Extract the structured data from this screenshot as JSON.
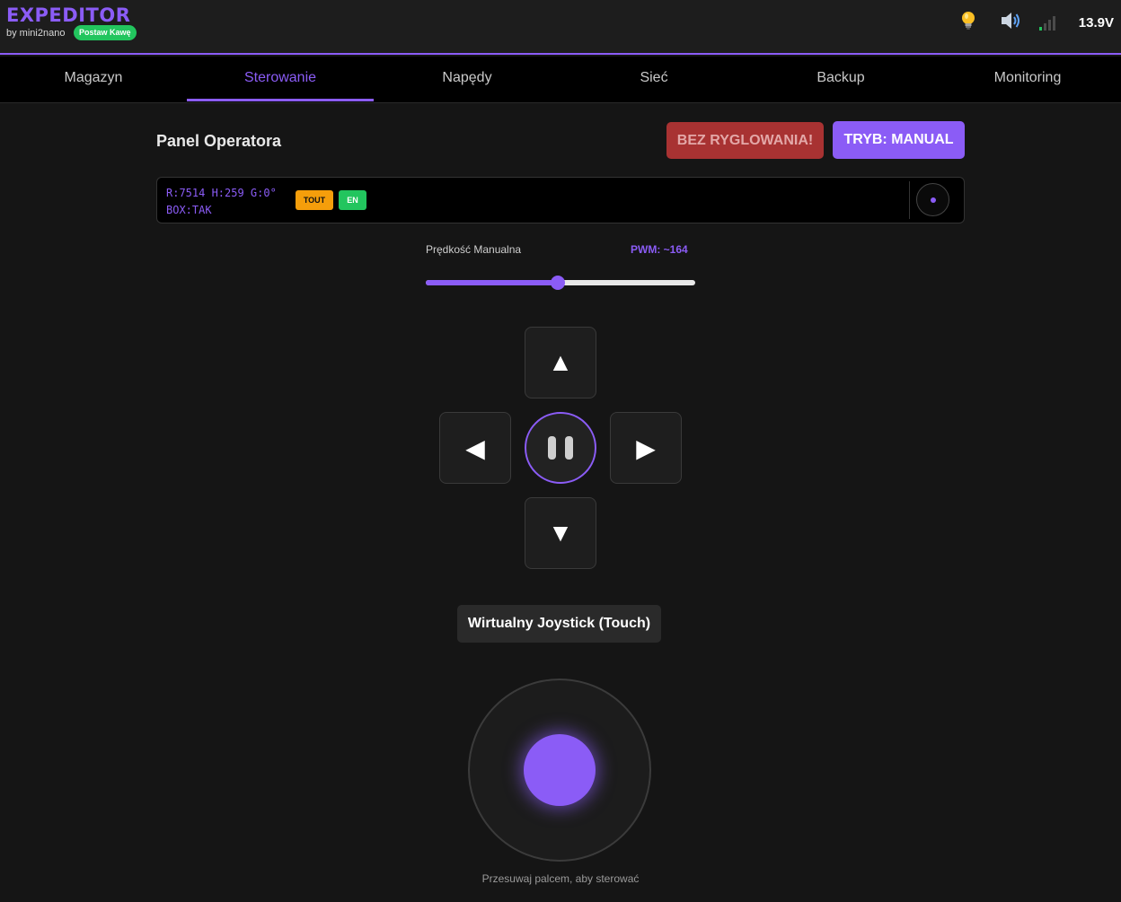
{
  "header": {
    "title": "EXPEDITOR",
    "subtitle": "by mini2nano",
    "coffee_badge": "Postaw Kawę",
    "icons": [
      "bulb-icon",
      "speaker-icon",
      "signal-icon"
    ],
    "voltage": "13.9V"
  },
  "tabs": [
    {
      "label": "Magazyn",
      "active": false
    },
    {
      "label": "Sterowanie",
      "active": true
    },
    {
      "label": "Napędy",
      "active": false
    },
    {
      "label": "Sieć",
      "active": false
    },
    {
      "label": "Backup",
      "active": false
    },
    {
      "label": "Monitoring",
      "active": false
    }
  ],
  "panel": {
    "title": "Panel Operatora",
    "lock_button": "BEZ RYGLOWANIA!",
    "mode_button": "TRYB: MANUAL"
  },
  "status": {
    "line1": "R:7514  H:259  G:0°",
    "line2": "BOX:TAK",
    "badge_tout": "TOUT",
    "badge_en": "EN"
  },
  "speed": {
    "label": "Prędkość Manualna",
    "pwm_label": "PWM: ~164",
    "value_fraction": 0.49
  },
  "dpad": {
    "up": "▲",
    "down": "▼",
    "left": "◀",
    "right": "▶"
  },
  "joystick": {
    "label": "Wirtualny Joystick (Touch)",
    "hint": "Przesuwaj palcem, aby sterować"
  },
  "colors": {
    "accent": "#8b5cf6",
    "danger": "#a83232",
    "success": "#22c55e",
    "warning": "#f59e0b",
    "background": "#151515"
  }
}
